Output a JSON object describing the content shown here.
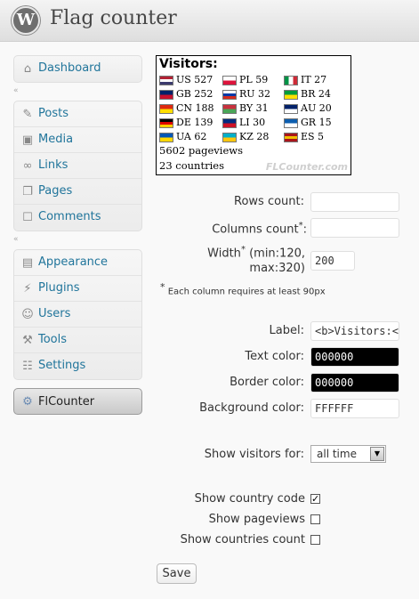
{
  "header": {
    "title": "Flag counter",
    "logo_letter": "W"
  },
  "sidebar": {
    "group1": [
      {
        "label": "Dashboard",
        "icon": "house-icon"
      }
    ],
    "group2": [
      {
        "label": "Posts",
        "icon": "pin-icon"
      },
      {
        "label": "Media",
        "icon": "media-icon"
      },
      {
        "label": "Links",
        "icon": "link-icon"
      },
      {
        "label": "Pages",
        "icon": "pages-icon"
      },
      {
        "label": "Comments",
        "icon": "comment-icon"
      }
    ],
    "group3": [
      {
        "label": "Appearance",
        "icon": "appearance-icon"
      },
      {
        "label": "Plugins",
        "icon": "plugin-icon"
      },
      {
        "label": "Users",
        "icon": "users-icon"
      },
      {
        "label": "Tools",
        "icon": "tools-icon"
      },
      {
        "label": "Settings",
        "icon": "settings-icon"
      }
    ],
    "flcounter": {
      "label": "FlCounter",
      "icon": "gear-icon"
    }
  },
  "widget": {
    "title": "Visitors:",
    "rows": [
      [
        {
          "code": "US",
          "count": "527",
          "colors": [
            "#b22234",
            "#fff",
            "#3c3b6e"
          ]
        },
        {
          "code": "PL",
          "count": "59",
          "colors": [
            "#fff",
            "#dc143c"
          ]
        },
        {
          "code": "IT",
          "count": "27",
          "colors": [
            "#009246",
            "#fff",
            "#ce2b37"
          ]
        }
      ],
      [
        {
          "code": "GB",
          "count": "252",
          "colors": [
            "#012169",
            "#c8102e"
          ]
        },
        {
          "code": "RU",
          "count": "32",
          "colors": [
            "#fff",
            "#0039a6",
            "#d52b1e"
          ]
        },
        {
          "code": "BR",
          "count": "24",
          "colors": [
            "#009c3b",
            "#ffdf00"
          ]
        }
      ],
      [
        {
          "code": "CN",
          "count": "188",
          "colors": [
            "#de2910",
            "#ffde00"
          ]
        },
        {
          "code": "BY",
          "count": "31",
          "colors": [
            "#c8313e",
            "#4aa657"
          ]
        },
        {
          "code": "AU",
          "count": "20",
          "colors": [
            "#012169",
            "#fff"
          ]
        }
      ],
      [
        {
          "code": "DE",
          "count": "139",
          "colors": [
            "#000",
            "#dd0000",
            "#ffce00"
          ]
        },
        {
          "code": "LI",
          "count": "30",
          "colors": [
            "#002b7f",
            "#ce1126"
          ]
        },
        {
          "code": "GR",
          "count": "15",
          "colors": [
            "#0d5eaf",
            "#fff"
          ]
        }
      ],
      [
        {
          "code": "UA",
          "count": "62",
          "colors": [
            "#0057b7",
            "#ffd700"
          ]
        },
        {
          "code": "KZ",
          "count": "28",
          "colors": [
            "#00afca",
            "#fec50c"
          ]
        },
        {
          "code": "ES",
          "count": "5",
          "colors": [
            "#aa151b",
            "#f1bf00",
            "#aa151b"
          ]
        }
      ]
    ],
    "pageviews": "5602 pageviews",
    "countries": "23 countries",
    "watermark": "FLCounter.com"
  },
  "form": {
    "rows_label": "Rows count:",
    "rows_value": "",
    "columns_label": "Columns count",
    "columns_star": "*",
    "columns_colon": ":",
    "columns_value": "",
    "width_label": "Width",
    "width_star": "*",
    "width_hint_line1": "(min:120,",
    "width_hint_line2": "max:320)",
    "width_value": "200",
    "note_star": "*",
    "note_text": "Each column requires at least 90px",
    "label_label": "Label:",
    "label_value": "<b>Visitors:</",
    "text_color_label": "Text color:",
    "text_color_value": "000000",
    "border_color_label": "Border color:",
    "border_color_value": "000000",
    "bg_color_label": "Background color:",
    "bg_color_value": "FFFFFF",
    "show_visitors_label": "Show visitors for:",
    "show_visitors_value": "all time",
    "show_country_code_label": "Show country code",
    "show_country_code_checked": true,
    "show_pageviews_label": "Show pageviews",
    "show_pageviews_checked": false,
    "show_countries_count_label": "Show countries count",
    "show_countries_count_checked": false,
    "save_label": "Save"
  }
}
